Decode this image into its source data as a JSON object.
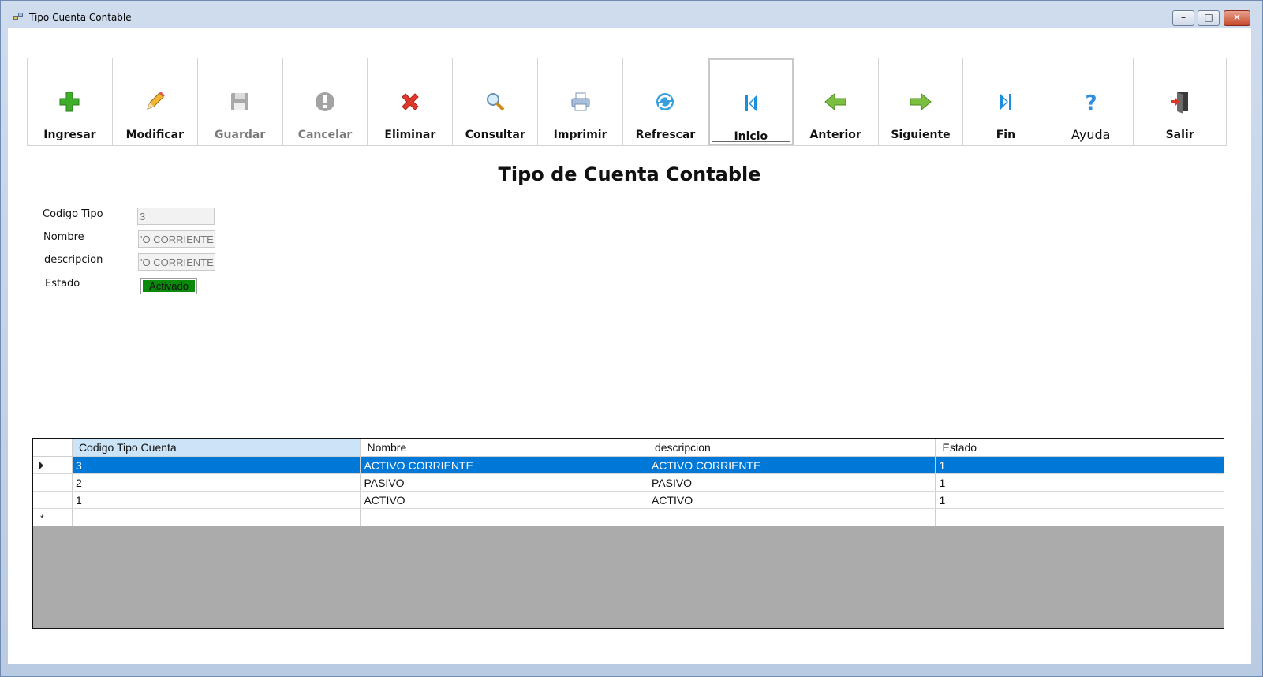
{
  "window": {
    "title": "Tipo Cuenta Contable",
    "min": "–",
    "max": "□",
    "close": "✕"
  },
  "toolbar": [
    {
      "label": "Ingresar",
      "icon": "plus-icon",
      "state": "enabled"
    },
    {
      "label": "Modificar",
      "icon": "pencil-icon",
      "state": "enabled"
    },
    {
      "label": "Guardar",
      "icon": "floppy-disk-icon",
      "state": "disabled"
    },
    {
      "label": "Cancelar",
      "icon": "cancel-icon",
      "state": "disabled"
    },
    {
      "label": "Eliminar",
      "icon": "delete-x-icon",
      "state": "enabled"
    },
    {
      "label": "Consultar",
      "icon": "magnifier-icon",
      "state": "enabled"
    },
    {
      "label": "Imprimir",
      "icon": "printer-icon",
      "state": "enabled"
    },
    {
      "label": "Refrescar",
      "icon": "refresh-icon",
      "state": "enabled"
    },
    {
      "label": "Inicio",
      "icon": "first-record-icon",
      "state": "focused"
    },
    {
      "label": "Anterior",
      "icon": "arrow-left-icon",
      "state": "enabled"
    },
    {
      "label": "Siguiente",
      "icon": "arrow-right-icon",
      "state": "enabled"
    },
    {
      "label": "Fin",
      "icon": "last-record-icon",
      "state": "enabled"
    },
    {
      "label": "Ayuda",
      "icon": "question-icon",
      "state": "enabled"
    },
    {
      "label": "Salir",
      "icon": "exit-door-icon",
      "state": "enabled"
    }
  ],
  "form": {
    "title": "Tipo de Cuenta Contable",
    "codigo_label": "Codigo Tipo",
    "codigo_value": "3",
    "nombre_label": "Nombre",
    "nombre_value": "'O CORRIENTE",
    "descripcion_label": "descripcion",
    "descripcion_value": "'O CORRIENTE",
    "estado_label": "Estado",
    "estado_value": "Activado"
  },
  "grid": {
    "columns": [
      "Codigo Tipo Cuenta",
      "Nombre",
      "descripcion",
      "Estado"
    ],
    "rows": [
      [
        "3",
        "ACTIVO CORRIENTE",
        "ACTIVO CORRIENTE",
        "1"
      ],
      [
        "2",
        "PASIVO",
        "PASIVO",
        "1"
      ],
      [
        "1",
        "ACTIVO",
        "ACTIVO",
        "1"
      ]
    ],
    "new_row_marker": "*"
  },
  "colors": {
    "selection": "#0078d7",
    "status_active": "#0a8a0a",
    "grid_empty": "#ababab"
  }
}
